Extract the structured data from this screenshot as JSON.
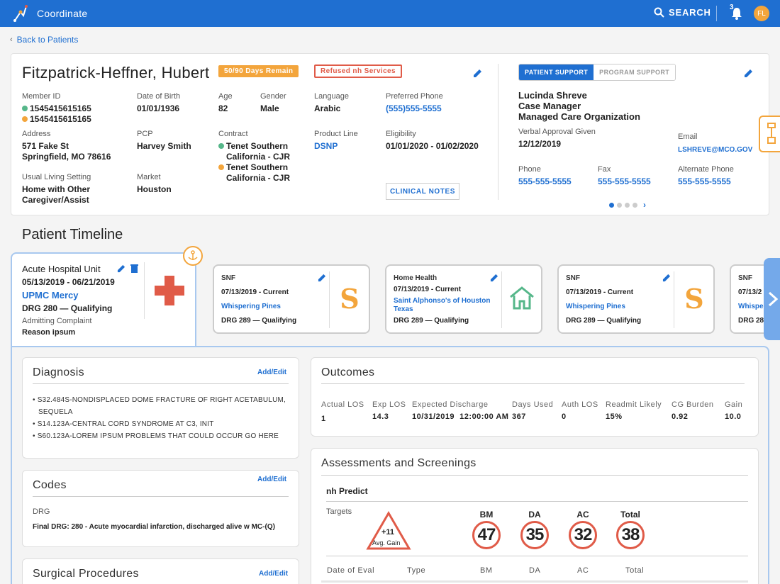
{
  "app": {
    "title": "Coordinate",
    "search_label": "SEARCH",
    "notification_count": "3",
    "user_initials": "FL"
  },
  "nav": {
    "back_label": "Back to Patients"
  },
  "patient": {
    "name": "Fitzpatrick-Heffner, Hubert",
    "days_remain": "50/90 Days Remain",
    "refused": "Refused nh Services",
    "member_id_label": "Member ID",
    "member_ids": [
      "1545415615165",
      "1545415615165"
    ],
    "dob_label": "Date of Birth",
    "dob": "01/01/1936",
    "age_label": "Age",
    "age": "82",
    "gender_label": "Gender",
    "gender": "Male",
    "language_label": "Language",
    "language": "Arabic",
    "phone_label": "Preferred Phone",
    "phone": "(555)555-5555",
    "address_label": "Address",
    "address_line1": "571 Fake St",
    "address_line2": "Springfield, MO 78616",
    "pcp_label": "PCP",
    "pcp": "Harvey Smith",
    "contract_label": "Contract",
    "contracts": [
      {
        "line1": "Tenet Southern",
        "line2": "California - CJR"
      },
      {
        "line1": "Tenet Southern",
        "line2": "California - CJR"
      }
    ],
    "product_label": "Product Line",
    "product": "DSNP",
    "eligibility_label": "Eligibility",
    "eligibility": "01/01/2020 - 01/02/2020",
    "living_label": "Usual Living Setting",
    "living_line1": "Home with Other",
    "living_line2": "Caregiver/Assist",
    "market_label": "Market",
    "market": "Houston",
    "clinical_notes": "CLINICAL NOTES"
  },
  "support": {
    "tabs": [
      "PATIENT SUPPORT",
      "PROGRAM SUPPORT"
    ],
    "name": "Lucinda Shreve",
    "role": "Case Manager",
    "org": "Managed Care Organization",
    "approval_label": "Verbal Approval Given",
    "approval": "12/12/2019",
    "email_label": "Email",
    "email": "LSHREVE@MCO.GOV",
    "phone_label": "Phone",
    "phone": "555-555-5555",
    "fax_label": "Fax",
    "fax": "555-555-5555",
    "alt_phone_label": "Alternate Phone",
    "alt_phone": "555-555-5555"
  },
  "timeline": {
    "title": "Patient Timeline",
    "current": {
      "type": "Acute Hospital Unit",
      "dates": "05/13/2019 - 06/21/2019",
      "facility": "UPMC Mercy",
      "drg": "DRG 280 — Qualifying",
      "complaint_label": "Admitting Complaint",
      "complaint": "Reason ipsum"
    },
    "cards": [
      {
        "type": "SNF",
        "dates": "07/13/2019 - Current",
        "facility": "Whispering Pines",
        "drg": "DRG 289 — Qualifying"
      },
      {
        "type": "Home Health",
        "dates": "07/13/2019 - Current",
        "facility": "Saint Alphonso's of Houston",
        "facility2": "Texas",
        "drg": "DRG 289 — Qualifying"
      },
      {
        "type": "SNF",
        "dates": "07/13/2019 - Current",
        "facility": "Whispering Pines",
        "drg": "DRG 289 — Qualifying"
      },
      {
        "type": "SNF",
        "dates": "07/13/2",
        "facility": "Whispe",
        "drg": "DRG 28"
      }
    ]
  },
  "diagnosis": {
    "title": "Diagnosis",
    "add_edit": "Add/Edit",
    "items": [
      "S32.484S-NONDISPLACED DOME FRACTURE OF RIGHT ACETABULUM,",
      "SEQUELA",
      "S14.123A-CENTRAL CORD SYNDROME AT C3, INIT",
      "S60.123A-LOREM IPSUM PROBLEMS THAT COULD OCCUR GO HERE"
    ]
  },
  "codes": {
    "title": "Codes",
    "add_edit": "Add/Edit",
    "drg_label": "DRG",
    "final_drg": "Final DRG: 280 - Acute myocardial infarction, discharged alive w MC-(Q)"
  },
  "surgical": {
    "title": "Surgical Procedures",
    "add_edit": "Add/Edit"
  },
  "outcomes": {
    "title": "Outcomes",
    "fields": [
      {
        "label": "Actual LOS",
        "value": "1"
      },
      {
        "label": "Exp LOS",
        "value": "14.3"
      },
      {
        "label": "Expected Discharge",
        "value": "10/31/2019  12:00:00 AM"
      },
      {
        "label": "Days Used",
        "value": "367"
      },
      {
        "label": "Auth LOS",
        "value": "0"
      },
      {
        "label": "Readmit Likely",
        "value": "15%"
      },
      {
        "label": "CG Burden",
        "value": "0.92"
      },
      {
        "label": "Gain",
        "value": "10.0"
      }
    ]
  },
  "assessments": {
    "title": "Assessments and Screenings",
    "subtitle": "nh Predict",
    "targets_label": "Targets",
    "gain_value": "+11",
    "gain_label": "Avg. Gain",
    "scores": [
      {
        "label": "BM",
        "value": "47"
      },
      {
        "label": "DA",
        "value": "35"
      },
      {
        "label": "AC",
        "value": "32"
      },
      {
        "label": "Total",
        "value": "38"
      }
    ],
    "columns": [
      "Date of Eval",
      "Type",
      "BM",
      "DA",
      "AC",
      "Total"
    ]
  },
  "colors": {
    "brand": "#1f6fd1",
    "accent": "#f3a53c",
    "alert": "#e05b48",
    "green": "#56b78a"
  }
}
